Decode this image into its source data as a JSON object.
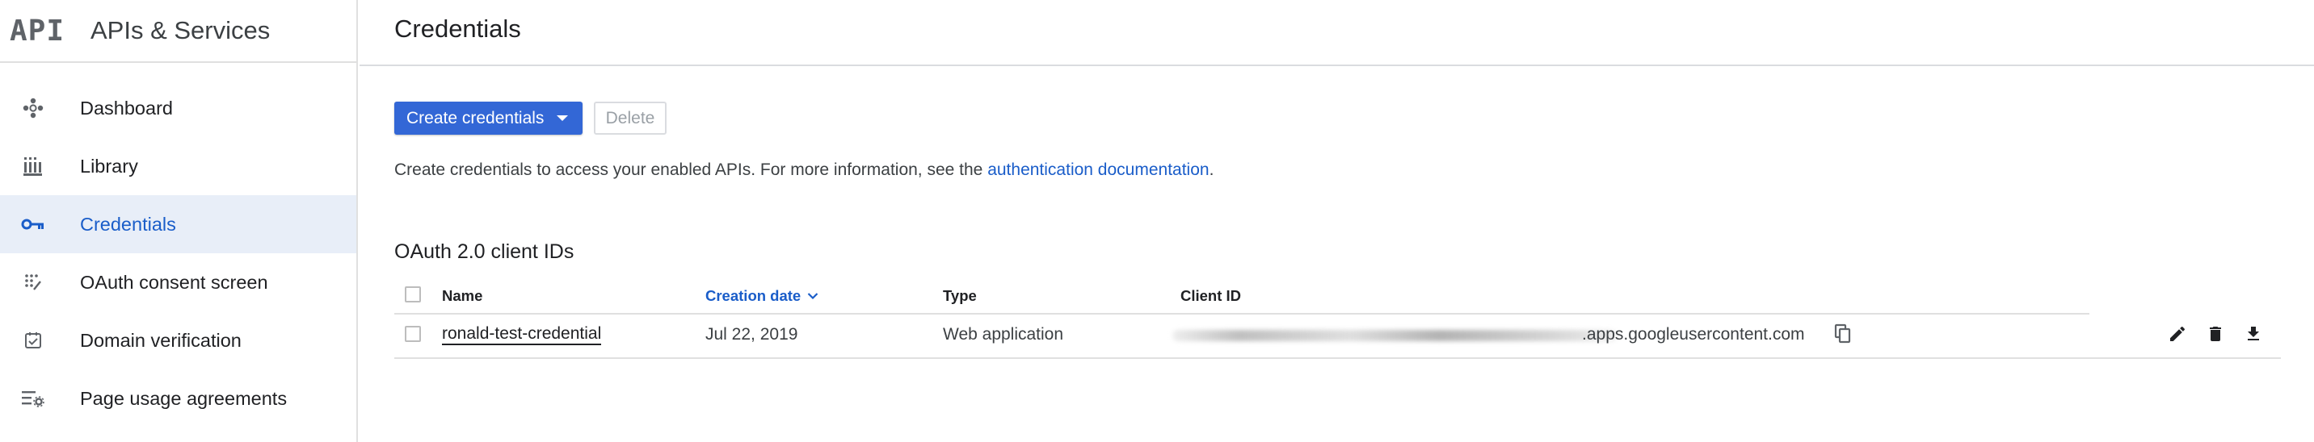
{
  "sidebar": {
    "logo": "API",
    "title": "APIs & Services",
    "items": [
      {
        "label": "Dashboard",
        "icon": "dashboard-icon"
      },
      {
        "label": "Library",
        "icon": "library-icon"
      },
      {
        "label": "Credentials",
        "icon": "key-icon",
        "active": true
      },
      {
        "label": "OAuth consent screen",
        "icon": "consent-icon"
      },
      {
        "label": "Domain verification",
        "icon": "verification-icon"
      },
      {
        "label": "Page usage agreements",
        "icon": "settings-list-icon"
      }
    ]
  },
  "main": {
    "title": "Credentials",
    "toolbar": {
      "create_label": "Create credentials",
      "delete_label": "Delete"
    },
    "info": {
      "text": "Create credentials to access your enabled APIs. For more information, see the ",
      "link": "authentication documentation",
      "suffix": "."
    },
    "oauth": {
      "title": "OAuth 2.0 client IDs",
      "columns": [
        "Name",
        "Creation date",
        "Type",
        "Client ID"
      ],
      "rows": [
        {
          "name": "ronald-test-credential",
          "created": "Jul 22, 2019",
          "type": "Web application",
          "client_id_suffix": ".apps.googleusercontent.com"
        }
      ]
    }
  },
  "colors": {
    "accent": "#3367d6",
    "link": "#1a5dc9",
    "active_bg": "#e8eef8"
  }
}
